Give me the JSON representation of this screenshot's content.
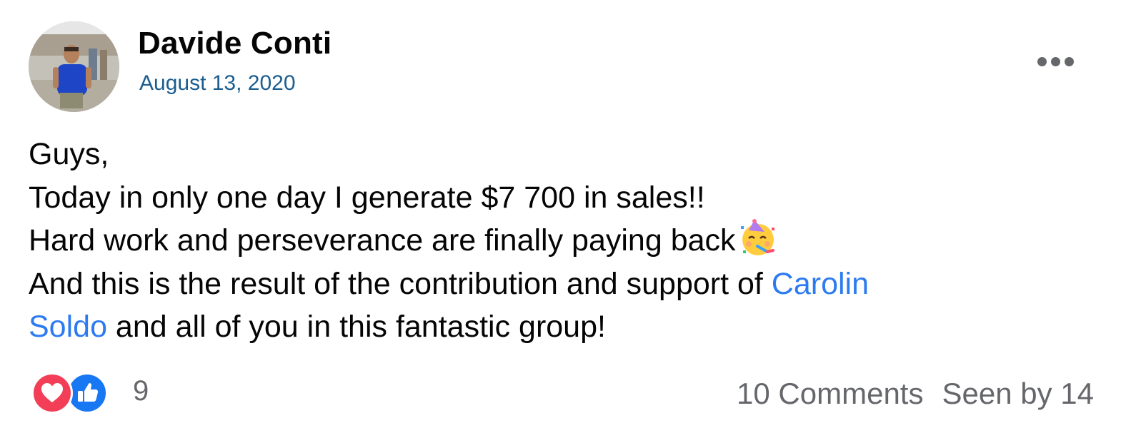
{
  "post": {
    "author": "Davide Conti",
    "date": "August 13, 2020",
    "more_icon": "more-horizontal-icon",
    "text": {
      "line1": "Guys,",
      "line2": "Today in only one day I generate $7 700 in sales!!",
      "line3": "Hard work and perseverance are finally paying back",
      "line3_emoji": "partying-face-emoji",
      "line4_pre": "And this is the result of the contribution and support of ",
      "mention_part1": "Carolin",
      "mention_part2": "Soldo",
      "line5_post": " and all of you in this fantastic group!"
    },
    "reactions": {
      "icons": [
        "heart-reaction-icon",
        "like-reaction-icon"
      ],
      "count": "9"
    },
    "comments": "10 Comments",
    "seen_by": "Seen by 14"
  },
  "colors": {
    "link": "#2d7bf0",
    "date": "#1b5d8f",
    "muted": "#65676b",
    "love": "#f33e58",
    "like": "#1877f2"
  }
}
